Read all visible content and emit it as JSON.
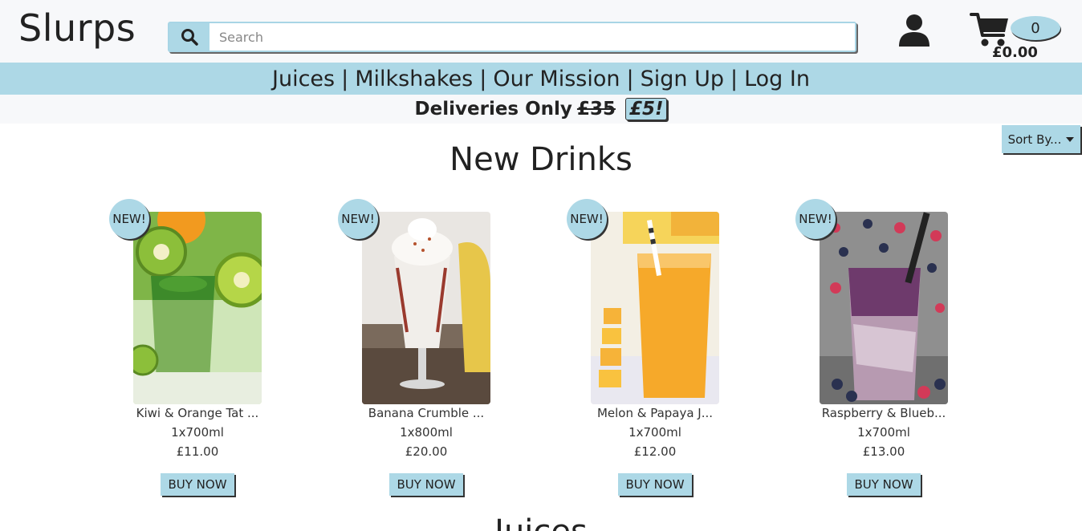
{
  "header": {
    "logo": "Slurps",
    "search": {
      "placeholder": "Search",
      "value": ""
    },
    "account_icon": "user-icon",
    "cart": {
      "icon": "cart-icon",
      "count": "0",
      "total": "£0.00"
    }
  },
  "nav": {
    "items": [
      {
        "label": "Juices"
      },
      {
        "label": "Milkshakes"
      },
      {
        "label": "Our Mission"
      },
      {
        "label": "Sign Up"
      },
      {
        "label": "Log In"
      }
    ],
    "separator": "|"
  },
  "promo": {
    "text": "Deliveries Only",
    "old_price": "£35",
    "new_price": "£5!"
  },
  "sort": {
    "label": "Sort By..."
  },
  "sections": [
    {
      "title": "New Drinks"
    },
    {
      "title": "Juices"
    }
  ],
  "products": [
    {
      "badge": "NEW!",
      "name": "Kiwi & Orange Tat ...",
      "size": "1x700ml",
      "price": "£11.00",
      "buy": "BUY NOW",
      "image": "kiwi-orange-drink"
    },
    {
      "badge": "NEW!",
      "name": "Banana Crumble ...",
      "size": "1x800ml",
      "price": "£20.00",
      "buy": "BUY NOW",
      "image": "banana-milkshake"
    },
    {
      "badge": "NEW!",
      "name": "Melon & Papaya J...",
      "size": "1x700ml",
      "price": "£12.00",
      "buy": "BUY NOW",
      "image": "melon-papaya-juice"
    },
    {
      "badge": "NEW!",
      "name": "Raspberry & Blueb...",
      "size": "1x700ml",
      "price": "£13.00",
      "buy": "BUY NOW",
      "image": "raspberry-blueberry-smoothie"
    }
  ],
  "colors": {
    "accent": "#add8e6",
    "header_bg": "#f7f8fa",
    "text": "#222222"
  }
}
